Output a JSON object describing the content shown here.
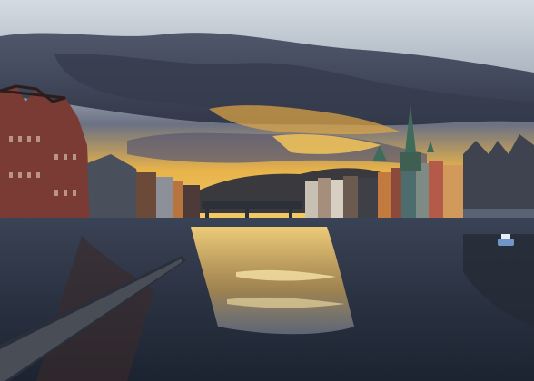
{
  "scene": {
    "subject": "river-waterfront-sunset",
    "palette": {
      "sky_top": "#c9d3dc",
      "cloud_dark": "#3b4356",
      "sunset_gold": "#f2c24a",
      "sunset_orange": "#e9a23a",
      "water_dark": "#232c3b",
      "water_reflection": "#f0c468",
      "warehouse_red": "#7a3b34",
      "warehouse_brown": "#6b4a3a",
      "building_gray": "#4a4f5c",
      "spire_green": "#3f6b5a"
    }
  }
}
